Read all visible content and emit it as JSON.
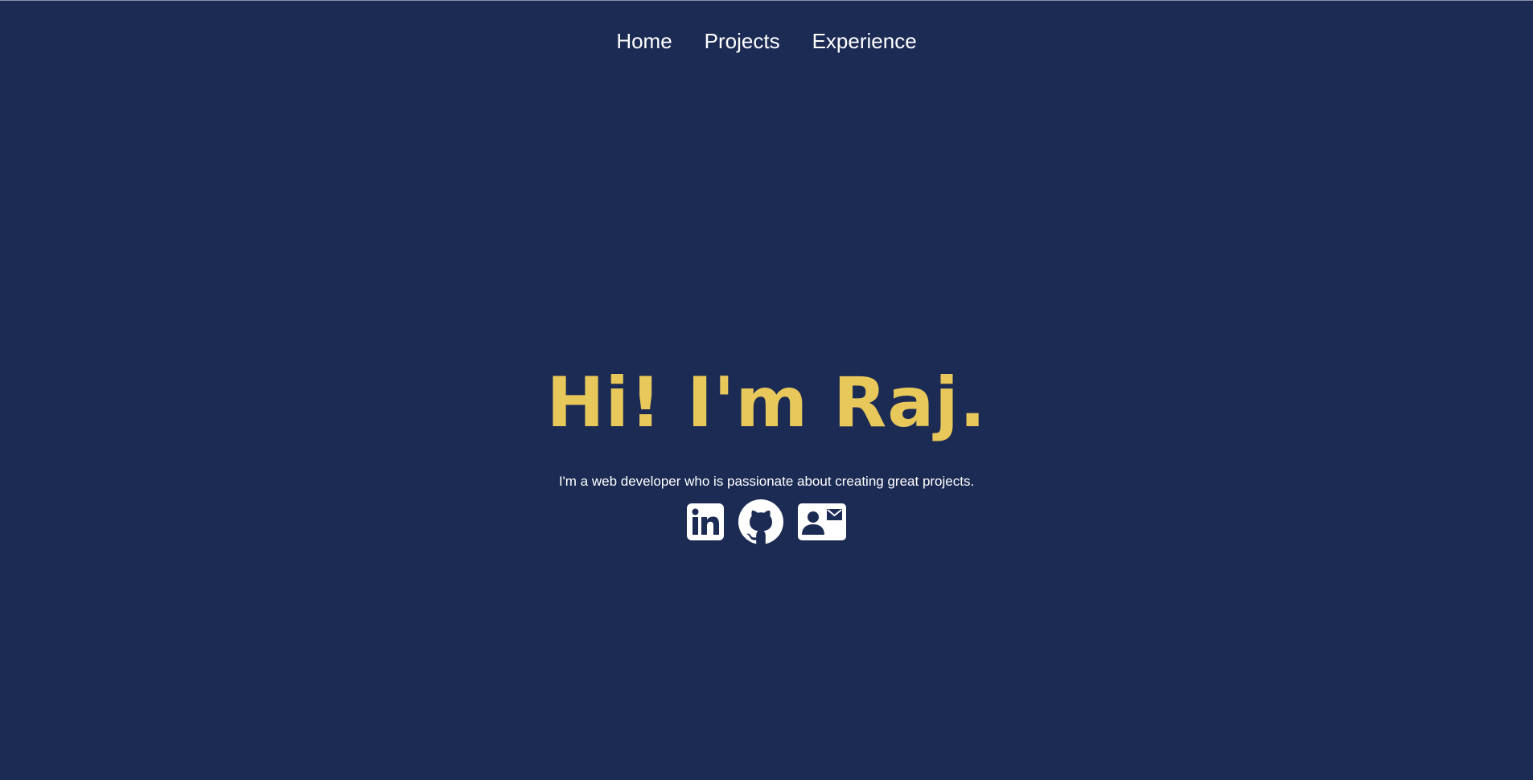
{
  "nav": {
    "items": [
      {
        "label": "Home"
      },
      {
        "label": "Projects"
      },
      {
        "label": "Experience"
      }
    ]
  },
  "hero": {
    "title": "Hi! I'm Raj.",
    "subtitle": "I'm a web developer who is passionate about creating great projects."
  },
  "social": {
    "icons": [
      "linkedin-icon",
      "github-icon",
      "contact-card-icon"
    ]
  },
  "colors": {
    "background": "#1c2b54",
    "accent": "#e8c85a",
    "text": "#ffffff"
  }
}
